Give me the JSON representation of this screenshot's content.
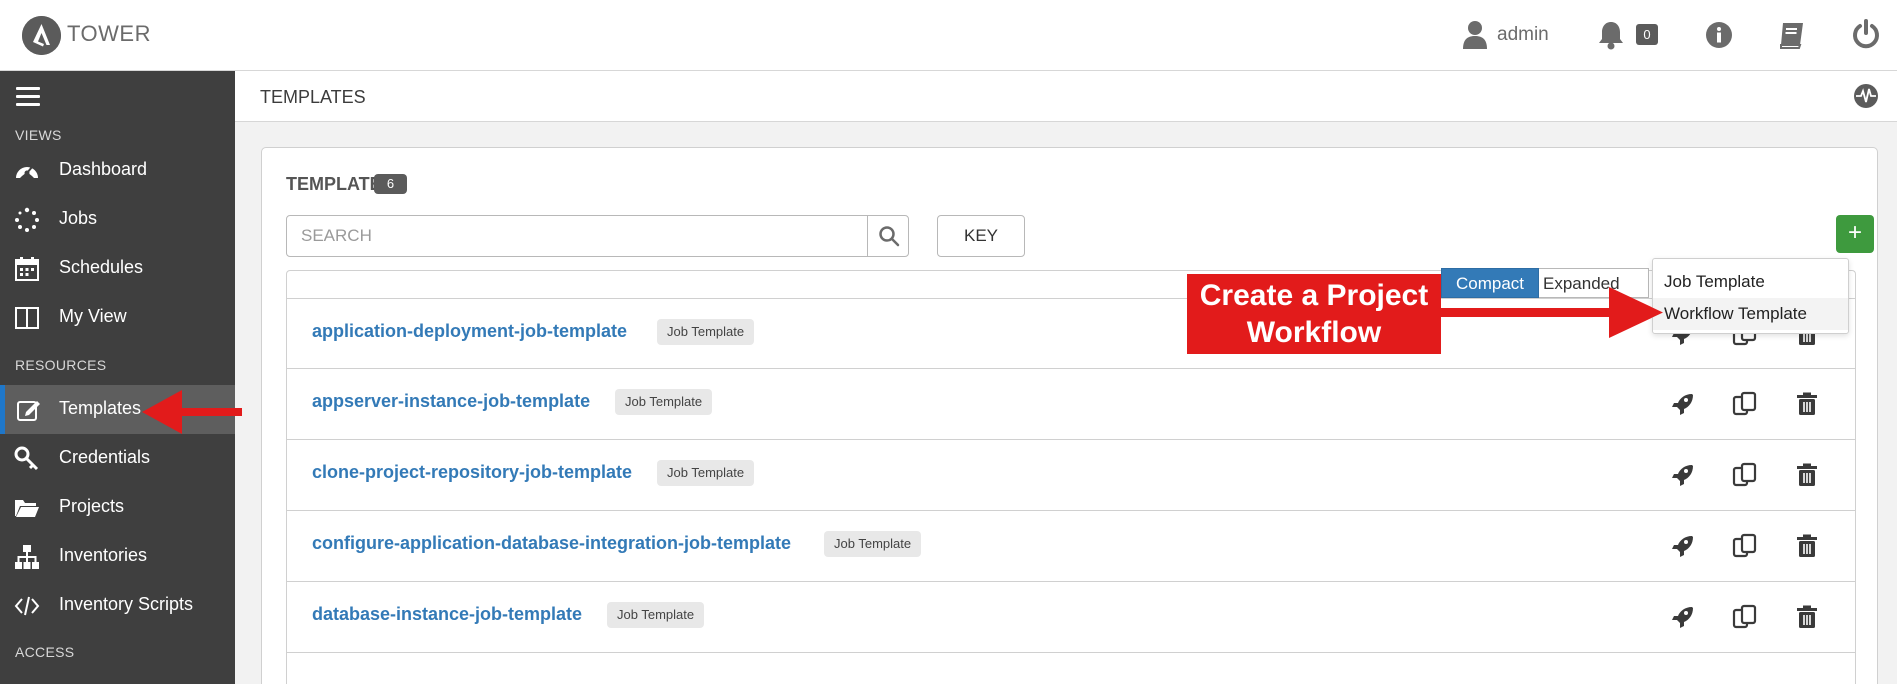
{
  "topbar": {
    "brand": "TOWER",
    "user_label": "admin",
    "notification_count": "0",
    "icons": [
      "tower-logo-icon",
      "user-icon",
      "bell-icon",
      "info-icon",
      "book-icon",
      "power-icon"
    ]
  },
  "sidebar": {
    "sections": {
      "views": "VIEWS",
      "resources": "RESOURCES",
      "access": "ACCESS"
    },
    "items": [
      {
        "label": "Dashboard",
        "icon": "dashboard-icon"
      },
      {
        "label": "Jobs",
        "icon": "jobs-icon"
      },
      {
        "label": "Schedules",
        "icon": "calendar-icon"
      },
      {
        "label": "My View",
        "icon": "columns-icon"
      },
      {
        "label": "Templates",
        "icon": "edit-icon",
        "active": true
      },
      {
        "label": "Credentials",
        "icon": "key-icon"
      },
      {
        "label": "Projects",
        "icon": "folder-icon"
      },
      {
        "label": "Inventories",
        "icon": "sitemap-icon"
      },
      {
        "label": "Inventory Scripts",
        "icon": "code-icon"
      }
    ],
    "active_color": "#1f77c9"
  },
  "main": {
    "breadcrumb": "TEMPLATES",
    "panel_title": "TEMPLATES",
    "panel_count": "6",
    "search_placeholder": "SEARCH",
    "key_label": "KEY",
    "add_label": "+",
    "toggle_compact": "Compact",
    "toggle_expanded": "Expanded",
    "add_menu": [
      "Job Template",
      "Workflow Template"
    ],
    "rows": [
      {
        "name": "application-deployment-job-template",
        "type": "Job Template"
      },
      {
        "name": "appserver-instance-job-template",
        "type": "Job Template"
      },
      {
        "name": "clone-project-repository-job-template",
        "type": "Job Template"
      },
      {
        "name": "configure-application-database-integration-job-template",
        "type": "Job Template"
      },
      {
        "name": "database-instance-job-template",
        "type": "Job Template"
      }
    ]
  },
  "annotation": {
    "line1": "Create a Project",
    "line2": "Workflow",
    "color": "#e21b1b"
  },
  "colors": {
    "link": "#337ab7",
    "add_button": "#3e9a3e",
    "sidebar_bg": "#3f3f3f"
  }
}
